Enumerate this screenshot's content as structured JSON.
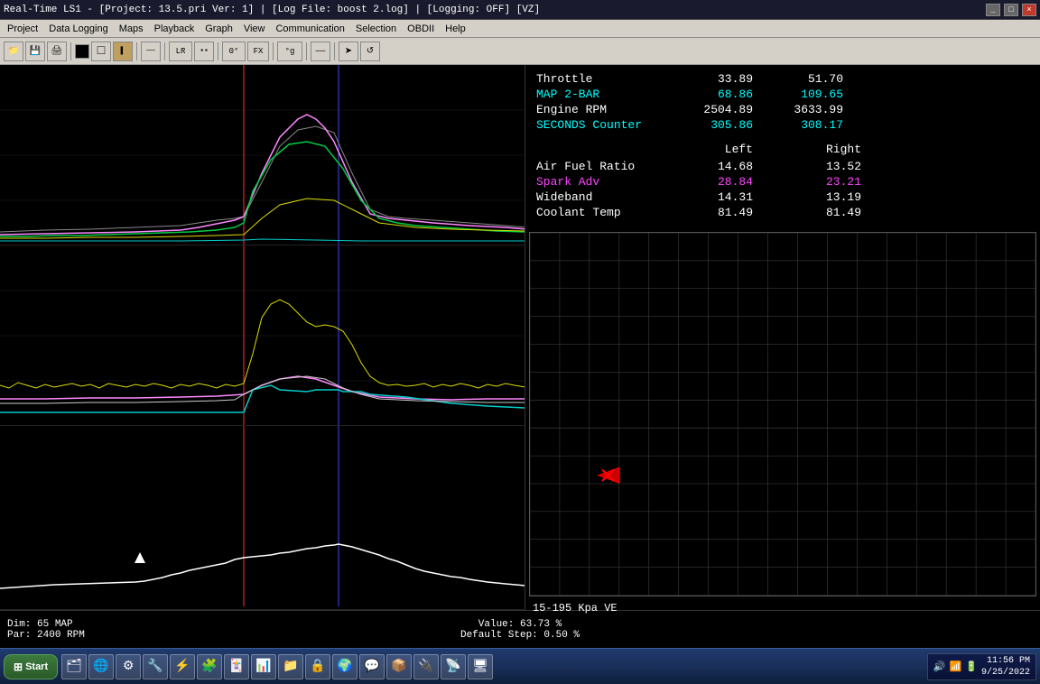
{
  "window": {
    "title": "Real-Time LS1 - [Project: 13.5.pri Ver: 1] | [Log File: boost 2.log] | [Logging: OFF] [VZ]",
    "controls": [
      "_",
      "□",
      "×"
    ]
  },
  "menu": {
    "items": [
      "Project",
      "Data Logging",
      "Maps",
      "Playback",
      "Graph",
      "View",
      "Communication",
      "Selection",
      "OBDII",
      "Help"
    ]
  },
  "toolbar": {
    "buttons": [
      "📂",
      "💾",
      "🔧",
      "■",
      "□",
      "▌",
      "—",
      "LR",
      "■■",
      "0°",
      "FX",
      "°g",
      "—",
      "➤",
      "↺"
    ]
  },
  "data": {
    "top_section": [
      {
        "label": "Throttle",
        "val1": "33.89",
        "val2": "51.70"
      },
      {
        "label": "MAP 2-BAR",
        "val1": "68.86",
        "val2": "109.65",
        "color": "cyan"
      },
      {
        "label": "Engine RPM",
        "val1": "2504.89",
        "val2": "3633.99"
      },
      {
        "label": "SECONDS Counter",
        "val1": "305.86",
        "val2": "308.17",
        "color": "cyan"
      }
    ],
    "headers": [
      "Left",
      "Right"
    ],
    "bottom_section": [
      {
        "label": "Air Fuel Ratio",
        "left": "14.68",
        "right": "13.52"
      },
      {
        "label": "Spark Adv",
        "left": "28.84",
        "right": "23.21",
        "color": "magenta"
      },
      {
        "label": "Wideband",
        "left": "14.31",
        "right": "13.19"
      },
      {
        "label": "Coolant Temp",
        "left": "81.49",
        "right": "81.49"
      }
    ]
  },
  "ve_map": {
    "title": "15-195 Kpa VE"
  },
  "status": {
    "dim_label": "Dim:",
    "dim_val": "65 MAP",
    "par_label": "Par:",
    "par_val": "2400 RPM",
    "value_label": "Value:",
    "value_val": "63.73 %",
    "step_label": "Default Step:",
    "step_val": "0.50 %"
  },
  "taskbar": {
    "start_label": "Start",
    "clock_time": "11:56 PM",
    "clock_date": "9/25/2022"
  },
  "icons": {
    "search": "🔍",
    "gear": "⚙",
    "window": "⊞",
    "arrow": "➤"
  }
}
